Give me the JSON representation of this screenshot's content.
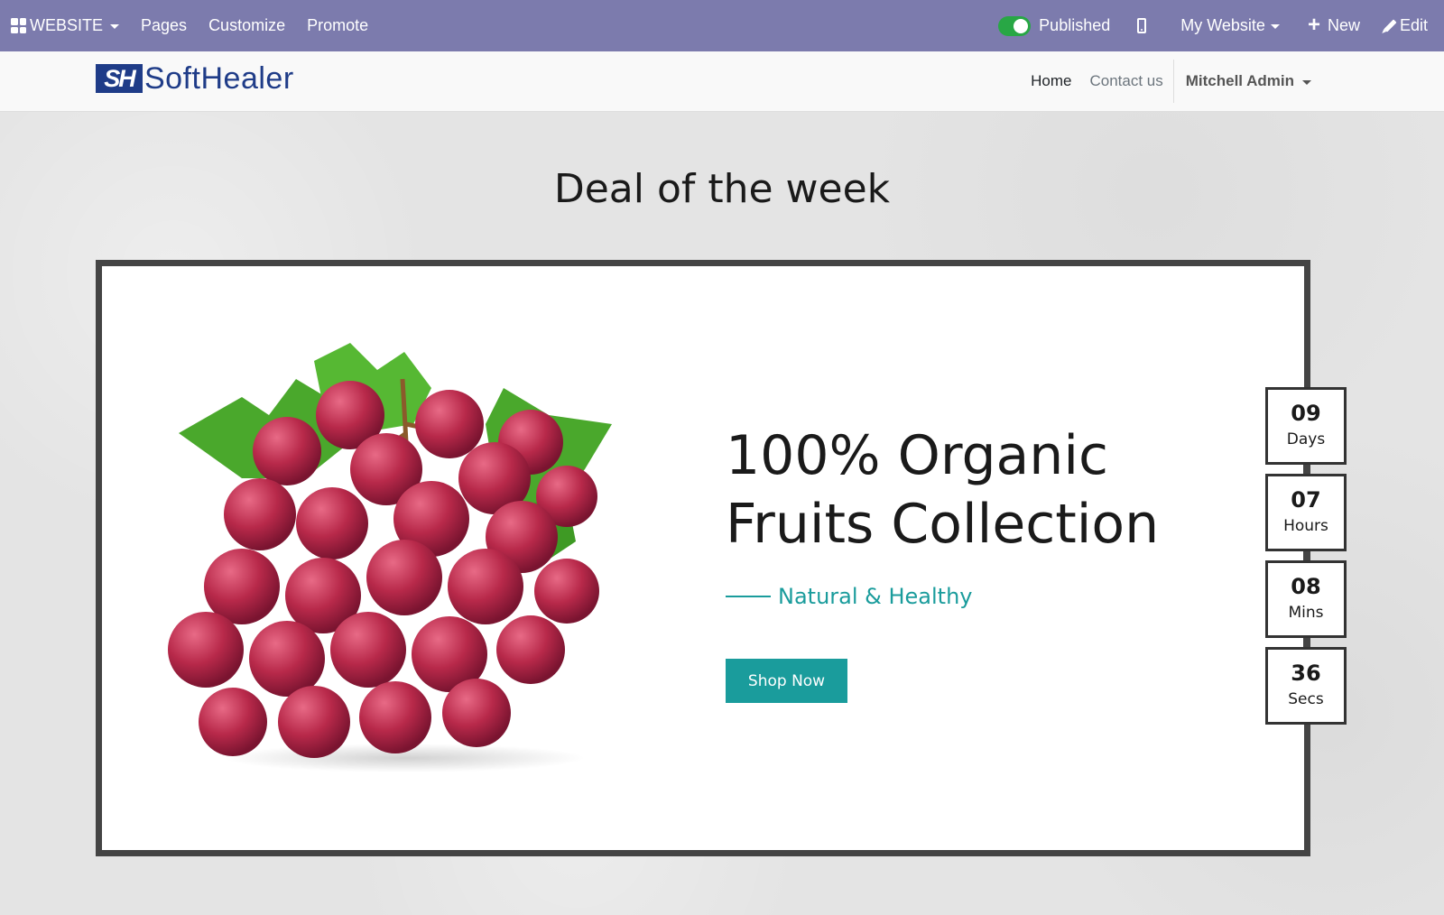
{
  "admin_bar": {
    "apps_label": "WEBSITE",
    "menu": [
      "Pages",
      "Customize",
      "Promote"
    ],
    "published_label": "Published",
    "site_label": "My Website",
    "new_label": "New",
    "edit_label": "Edit",
    "accent_color": "#7c7bad",
    "toggle_color": "#28a745"
  },
  "header": {
    "logo_mark": "SH",
    "logo_text": "SoftHealer",
    "nav": [
      "Home",
      "Contact us"
    ],
    "user_name": "Mitchell Admin"
  },
  "hero": {
    "title": "Deal of the week",
    "offer_title": "100% Organic Fruits Collection",
    "subtitle": "Natural & Healthy",
    "button_label": "Shop Now",
    "accent_color": "#1a9c9c",
    "image": "grapes-image"
  },
  "countdown": [
    {
      "value": "09",
      "unit": "Days"
    },
    {
      "value": "07",
      "unit": "Hours"
    },
    {
      "value": "08",
      "unit": "Mins"
    },
    {
      "value": "36",
      "unit": "Secs"
    }
  ]
}
